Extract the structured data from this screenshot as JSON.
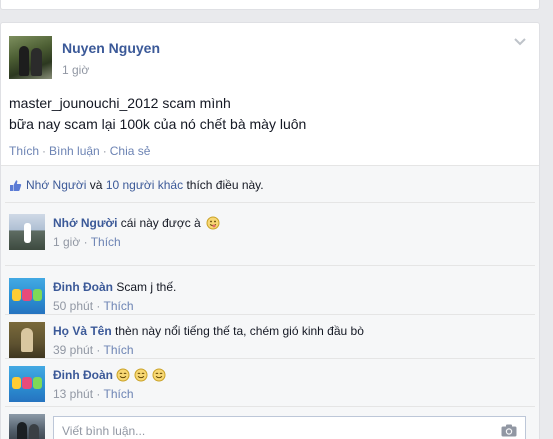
{
  "post": {
    "author": "Nuyen Nguyen",
    "time": "1 giờ",
    "message_line1": "master_jounouchi_2012 scam mình",
    "message_line2": "bữa nay scam lại 100k của nó chết bà mày luôn",
    "actions": {
      "like": "Thích",
      "comment": "Bình luận",
      "share": "Chia sẻ",
      "separator": "·"
    }
  },
  "likes": {
    "person": "Nhớ Người",
    "and": "và",
    "others": "10 người khác",
    "suffix": "thích điều này."
  },
  "comments": [
    {
      "name": "Nhớ Người",
      "text": "cái này được à",
      "emoji": "tongue-face-icon",
      "time": "1 giờ",
      "like": "Thích"
    },
    {
      "name": "Đinh Đoàn",
      "text": "Scam j thế.",
      "time": "50 phút",
      "like": "Thích"
    },
    {
      "name": "Họ Và Tên",
      "text": "thèn này nổi tiếng thế ta, chém gió kinh đầu bò",
      "time": "39 phút",
      "like": "Thích"
    },
    {
      "name": "Đinh Đoàn",
      "text": "",
      "emoji": "smile-face-icon",
      "emoji_count": 3,
      "time": "13 phút",
      "like": "Thích"
    }
  ],
  "reply": {
    "placeholder": "Viết bình luận..."
  },
  "colors": {
    "link": "#3b5998",
    "muted": "#9197a3",
    "action": "#6d84b4",
    "background": "#e9eaed"
  }
}
